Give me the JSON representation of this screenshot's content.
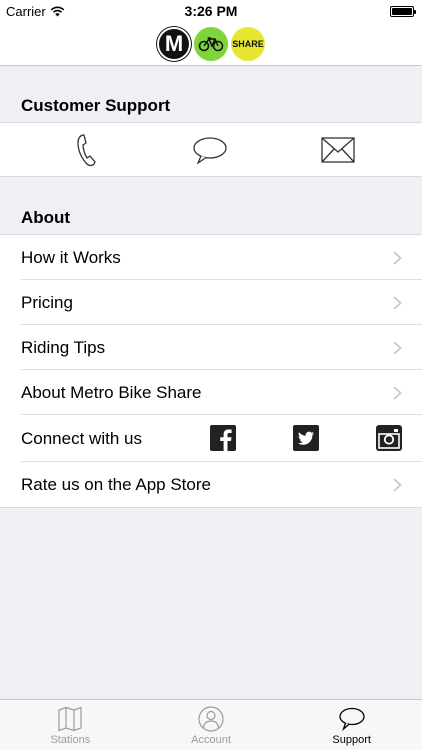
{
  "status_bar": {
    "carrier": "Carrier",
    "time": "3:26 PM"
  },
  "header": {
    "logos": [
      "M",
      "bike-icon",
      "SHARE"
    ]
  },
  "customer_support": {
    "title": "Customer Support",
    "icons": [
      "phone-icon",
      "chat-bubble-icon",
      "mail-icon"
    ]
  },
  "about": {
    "title": "About",
    "items": [
      {
        "label": "How it Works"
      },
      {
        "label": "Pricing"
      },
      {
        "label": "Riding Tips"
      },
      {
        "label": "About Metro Bike Share"
      },
      {
        "label": "Connect with us"
      },
      {
        "label": "Rate us on the App Store"
      }
    ],
    "social": [
      "facebook-icon",
      "twitter-icon",
      "instagram-icon"
    ]
  },
  "tabbar": {
    "tabs": [
      {
        "label": "Stations",
        "icon": "map-icon"
      },
      {
        "label": "Account",
        "icon": "person-icon"
      },
      {
        "label": "Support",
        "icon": "chat-bubble-icon"
      }
    ],
    "active": "Support"
  },
  "colors": {
    "background": "#efeff4",
    "bike_green": "#7fd33b",
    "share_yellow": "#e6e630"
  }
}
